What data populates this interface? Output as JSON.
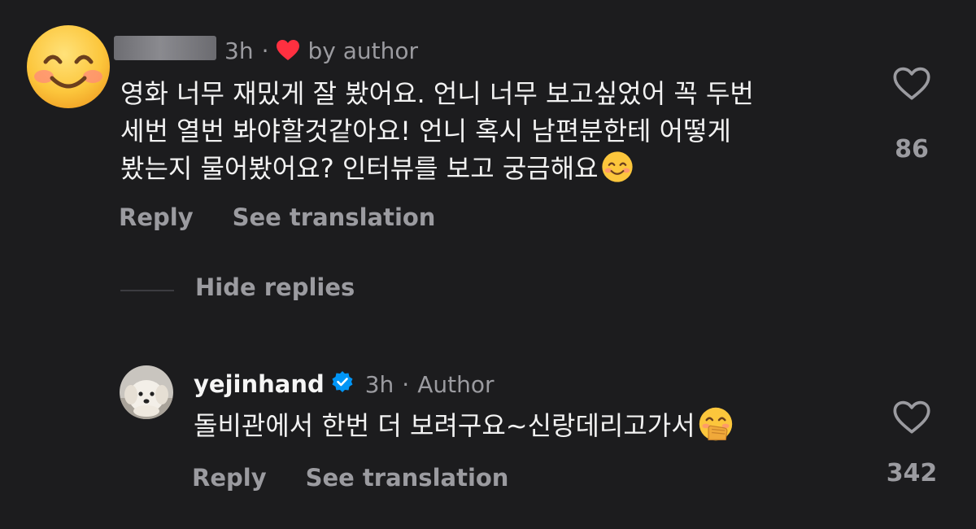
{
  "comment": {
    "time": "3h",
    "separator": "·",
    "liked_by": "by author",
    "text_line1": "영화 너무 재밌게 잘 봤어요. 언니 너무 보고싶었어 꼭 두번",
    "text_line2": "세번 열번 봐야할것같아요! 언니 혹시 남편분한테 어떻게",
    "text_line3": "봤는지 물어봤어요? 인터뷰를 보고 궁금해요",
    "reply_label": "Reply",
    "translate_label": "See translation",
    "like_count": "86"
  },
  "hide_replies": "Hide replies",
  "reply": {
    "username": "yejinhand",
    "time": "3h",
    "separator": "·",
    "role": "Author",
    "text": "돌비관에서 한번 더 보려구요~신랑데리고가서",
    "reply_label": "Reply",
    "translate_label": "See translation",
    "like_count": "342"
  },
  "colors": {
    "background": "#1c1c1e",
    "secondary_text": "#9b9ba0",
    "heart_red": "#ff3040",
    "verified_blue": "#0095f6"
  }
}
